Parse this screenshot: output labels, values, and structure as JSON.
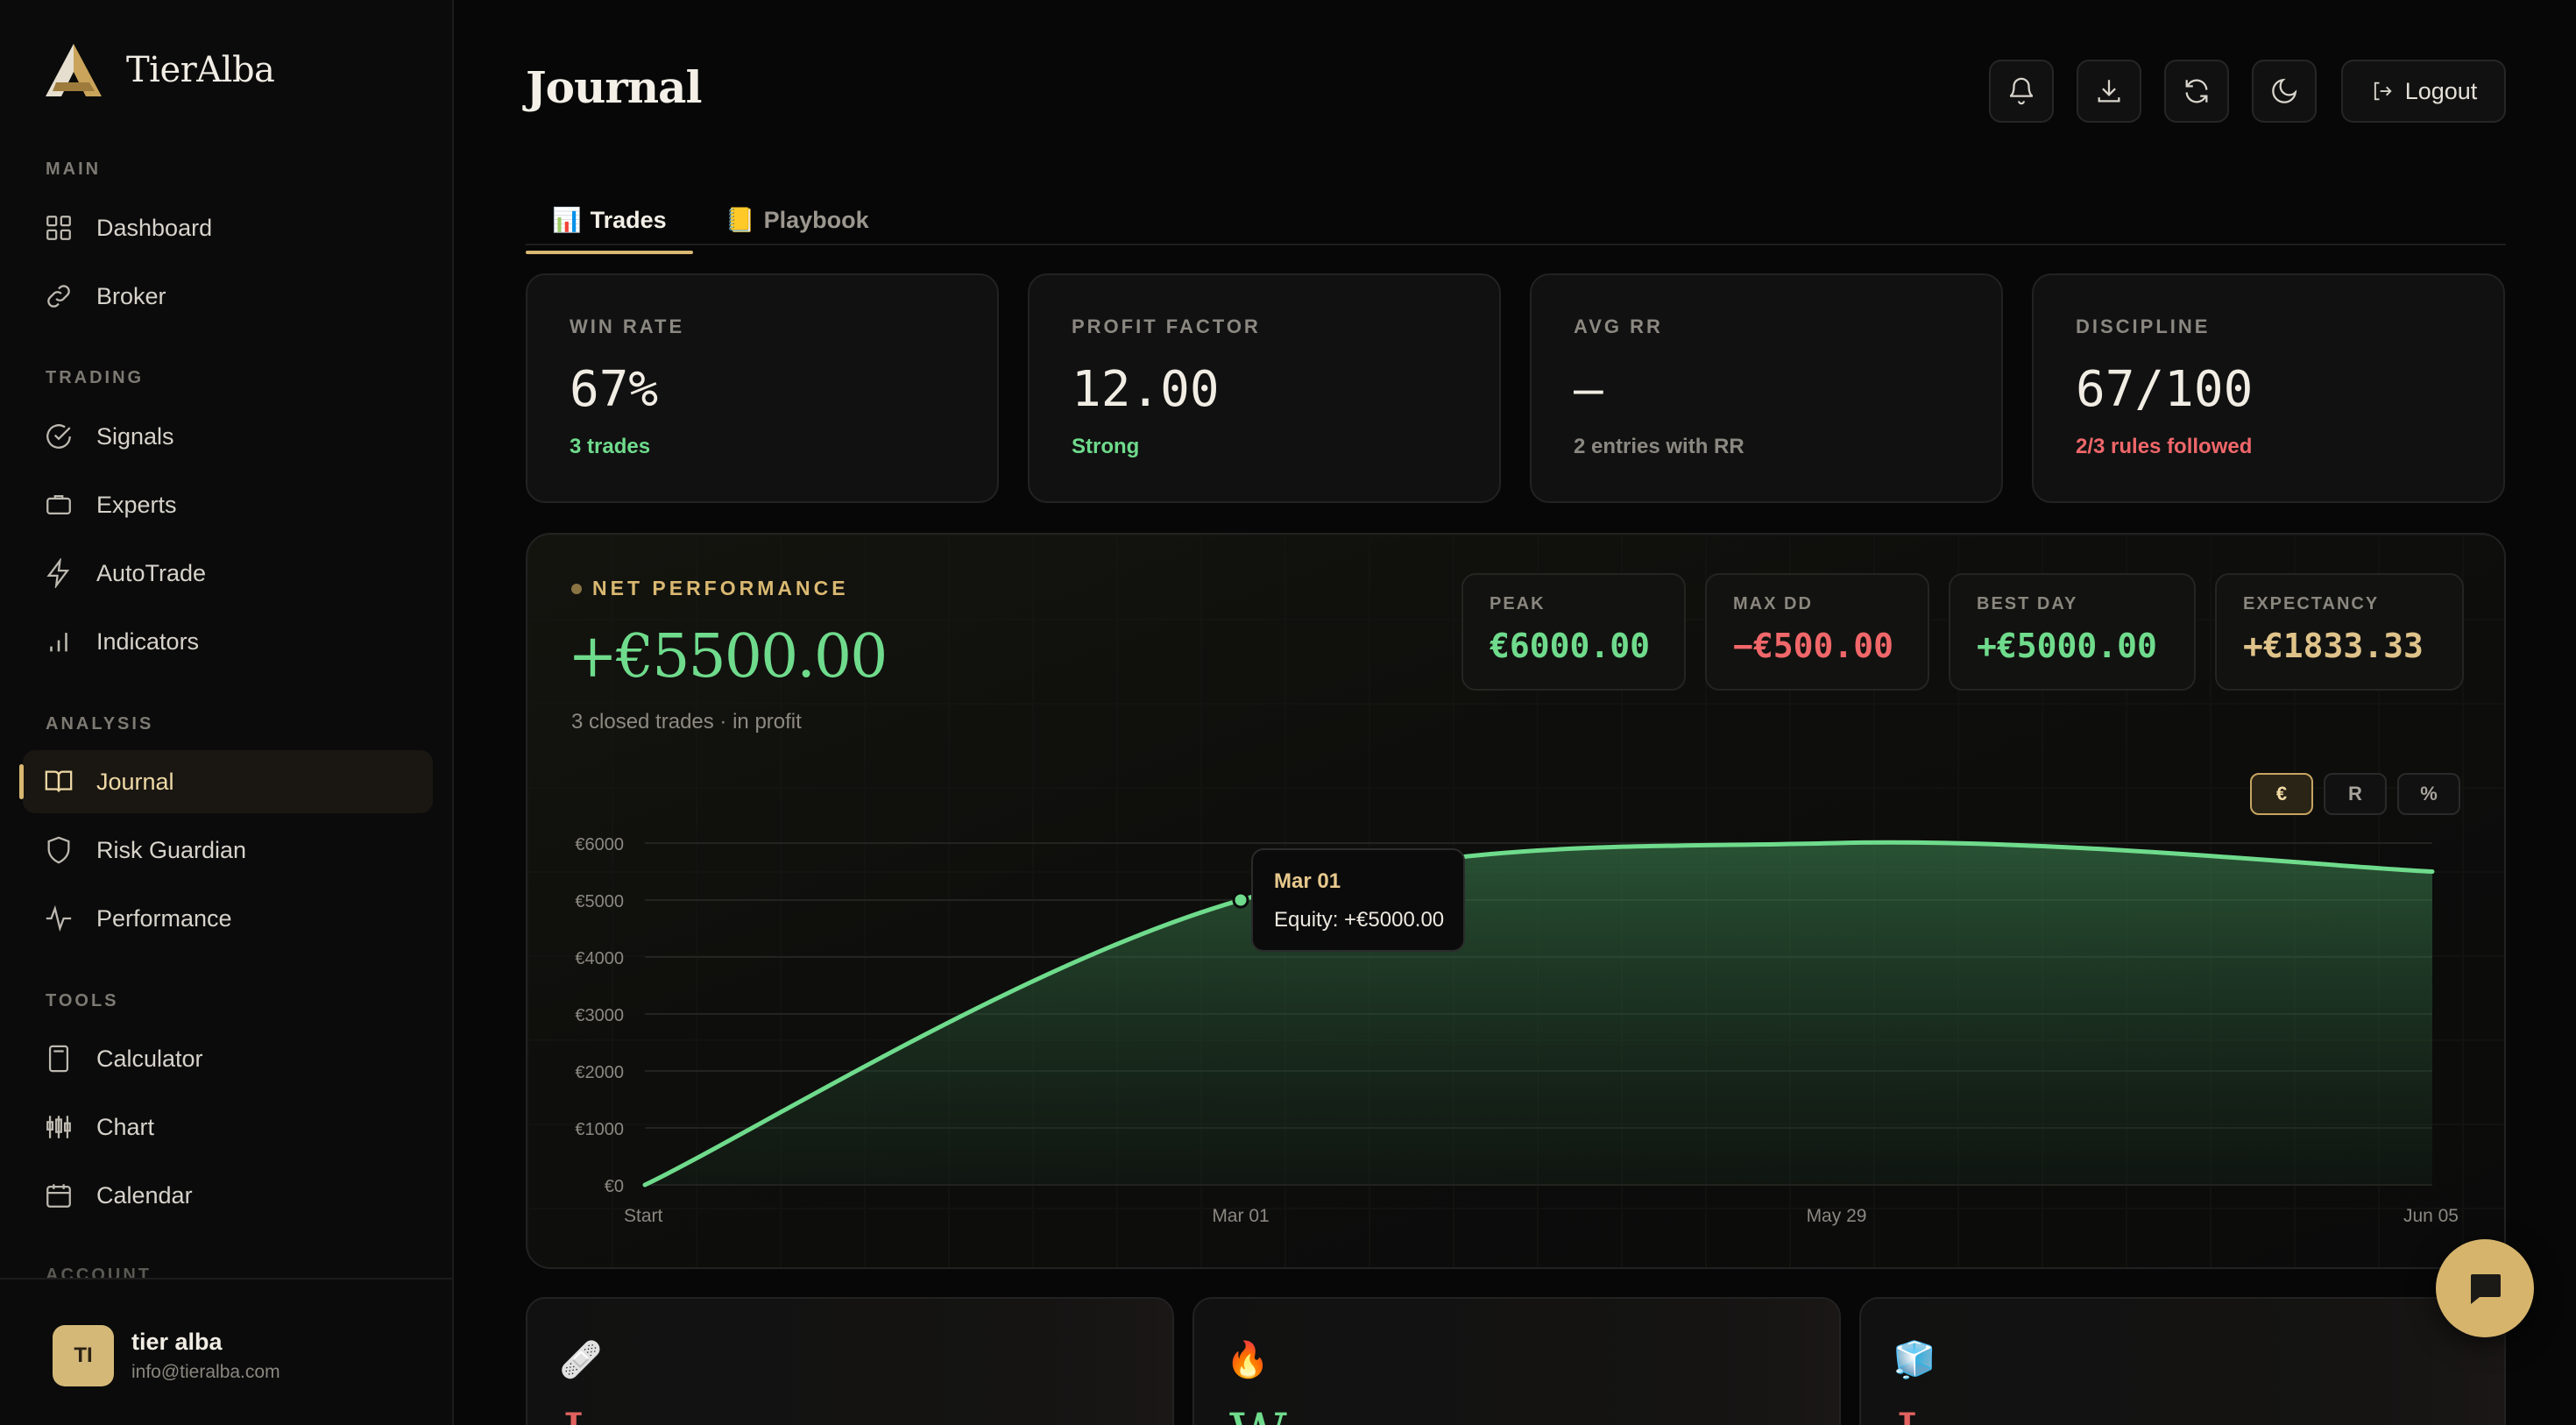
{
  "brand": {
    "name": "TierAlba"
  },
  "sidebar": {
    "sections": {
      "main": "MAIN",
      "trading": "TRADING",
      "analysis": "ANALYSIS",
      "tools": "TOOLS",
      "account": "ACCOUNT"
    },
    "items": {
      "dashboard": "Dashboard",
      "broker": "Broker",
      "signals": "Signals",
      "experts": "Experts",
      "autotrade": "AutoTrade",
      "indicators": "Indicators",
      "journal": "Journal",
      "risk_guardian": "Risk Guardian",
      "performance": "Performance",
      "calculator": "Calculator",
      "chart": "Chart",
      "calendar": "Calendar"
    },
    "active_item": "Journal",
    "user": {
      "initials": "TI",
      "name": "tier alba",
      "email": "info@tieralba.com"
    }
  },
  "header": {
    "title": "Journal",
    "logout_label": "Logout",
    "icons": [
      "bell-icon",
      "download-icon",
      "refresh-icon",
      "moon-icon",
      "logout-icon"
    ]
  },
  "tabs": [
    {
      "icon": "📊",
      "label": "Trades",
      "active": true
    },
    {
      "icon": "📒",
      "label": "Playbook",
      "active": false
    }
  ],
  "stats": [
    {
      "label": "WIN RATE",
      "value": "67%",
      "sub": "3 trades",
      "sub_color": "#6fdb8c"
    },
    {
      "label": "PROFIT FACTOR",
      "value": "12.00",
      "sub": "Strong",
      "sub_color": "#6fdb8c"
    },
    {
      "label": "AVG RR",
      "value": "—",
      "sub": "2 entries with RR",
      "sub_color": "#8b8881"
    },
    {
      "label": "DISCIPLINE",
      "value": "67/100",
      "sub": "2/3 rules followed",
      "sub_color": "#f0676a"
    }
  ],
  "performance": {
    "label": "NET PERFORMANCE",
    "value": "+€5500.00",
    "subtitle": "3 closed trades · in profit",
    "metrics": [
      {
        "label": "PEAK",
        "value": "€6000.00",
        "color": "#6fdb8c"
      },
      {
        "label": "MAX DD",
        "value": "−€500.00",
        "color": "#f0676a"
      },
      {
        "label": "BEST DAY",
        "value": "+€5000.00",
        "color": "#6fdb8c"
      },
      {
        "label": "EXPECTANCY",
        "value": "+€1833.33",
        "color": "#e0c38a"
      }
    ],
    "toggles": [
      {
        "label": "€",
        "active": true
      },
      {
        "label": "R",
        "active": false
      },
      {
        "label": "%",
        "active": false
      }
    ],
    "tooltip": {
      "date": "Mar 01",
      "text": "Equity: +€5000.00"
    }
  },
  "chart_data": {
    "type": "area",
    "x": [
      "Start",
      "Mar 01",
      "May 29",
      "Jun 05"
    ],
    "series": [
      {
        "values": [
          0,
          5000,
          6000,
          5500
        ]
      }
    ],
    "yticks": [
      "€0",
      "€1000",
      "€2000",
      "€3000",
      "€4000",
      "€5000",
      "€6000"
    ],
    "ylim": [
      0,
      6000
    ],
    "line_color": "#6fdb8c",
    "grid": true
  },
  "bottom_cards": [
    {
      "icon": "🩹",
      "letter": "L",
      "color": "#e0625f"
    },
    {
      "icon": "🔥",
      "letter": "W",
      "color": "#6fdb8c"
    },
    {
      "icon": "🧊",
      "letter": "L",
      "color": "#e0625f"
    }
  ],
  "colors": {
    "accent": "#d9b871",
    "profit": "#6fdb8c",
    "loss": "#f0676a",
    "background": "#070707"
  }
}
